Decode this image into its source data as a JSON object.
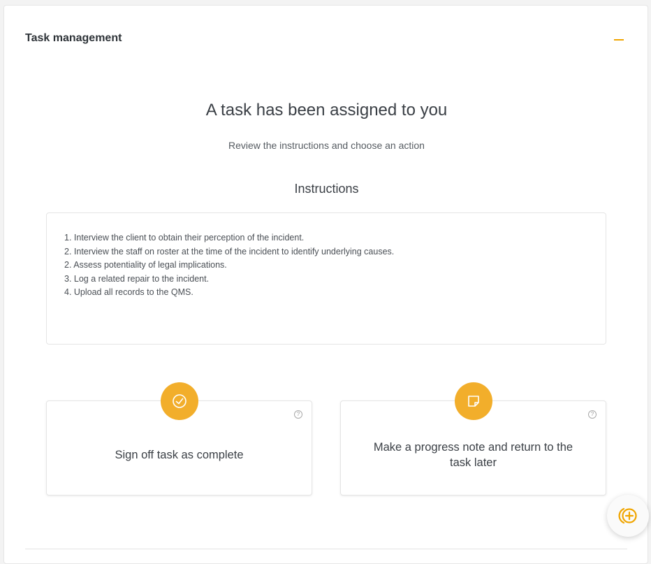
{
  "panel": {
    "title": "Task management"
  },
  "main": {
    "heading": "A task has been assigned to you",
    "subheading": "Review the instructions and choose an action",
    "instructions_title": "Instructions",
    "instructions": [
      "1. Interview the client to obtain their perception of the incident.",
      "2. Interview the staff on roster at the time of the incident to identify underlying causes.",
      "2. Assess potentiality of legal implications.",
      "3. Log a related repair to the incident.",
      "4. Upload all records to the QMS."
    ]
  },
  "actions": {
    "sign_off": {
      "label": "Sign off task as complete",
      "icon": "check-circle-icon",
      "help": "?"
    },
    "progress_note": {
      "label": "Make a progress note and return to the task later",
      "icon": "note-icon",
      "help": "?"
    }
  },
  "colors": {
    "accent": "#f2ae2b",
    "accent_dark": "#f0a500"
  }
}
